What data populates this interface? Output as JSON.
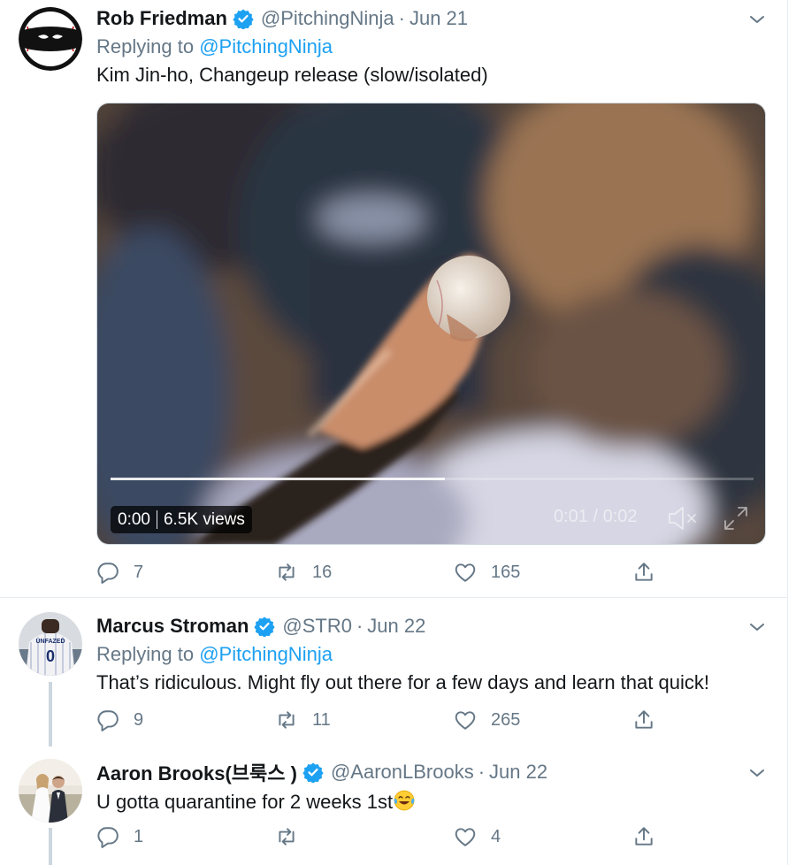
{
  "tweets": [
    {
      "display_name": "Rob Friedman",
      "handle": "@PitchingNinja",
      "separator": "·",
      "date": "Jun 21",
      "replying_prefix": "Replying to",
      "replying_to": "@PitchingNinja",
      "text": "Kim Jin-ho, Changeup release (slow/isolated)",
      "avatar_icon": "ninja-baseball-avatar",
      "media": {
        "elapsed": "0:00",
        "views": "6.5K views",
        "time_display": "0:01 / 0:02",
        "progress_fraction": 0.52
      },
      "actions": {
        "replies": "7",
        "retweets": "16",
        "likes": "165"
      }
    },
    {
      "display_name": "Marcus Stroman",
      "handle": "@STR0",
      "separator": "·",
      "date": "Jun 22",
      "replying_prefix": "Replying to",
      "replying_to": "@PitchingNinja",
      "text": "That’s ridiculous. Might fly out there for a few days and learn that quick!",
      "avatar_icon": "jersey-photo-avatar",
      "actions": {
        "replies": "9",
        "retweets": "11",
        "likes": "265"
      }
    },
    {
      "display_name": "Aaron Brooks(브룩스 )",
      "handle": "@AaronLBrooks",
      "separator": "·",
      "date": "Jun 22",
      "text": "U gotta quarantine for 2 weeks 1st",
      "text_emoji": "face-with-tears-of-joy",
      "avatar_icon": "couple-photo-avatar",
      "actions": {
        "replies": "1",
        "retweets": "",
        "likes": "4"
      }
    }
  ],
  "colors": {
    "link": "#1da1f2",
    "secondary_text": "#657786",
    "verified_badge": "#1da1f2",
    "border": "#e6ecf0"
  },
  "icons": [
    "caret-down-icon",
    "verified-badge-icon",
    "reply-icon",
    "retweet-icon",
    "like-icon",
    "share-icon",
    "mute-icon",
    "fullscreen-icon"
  ]
}
